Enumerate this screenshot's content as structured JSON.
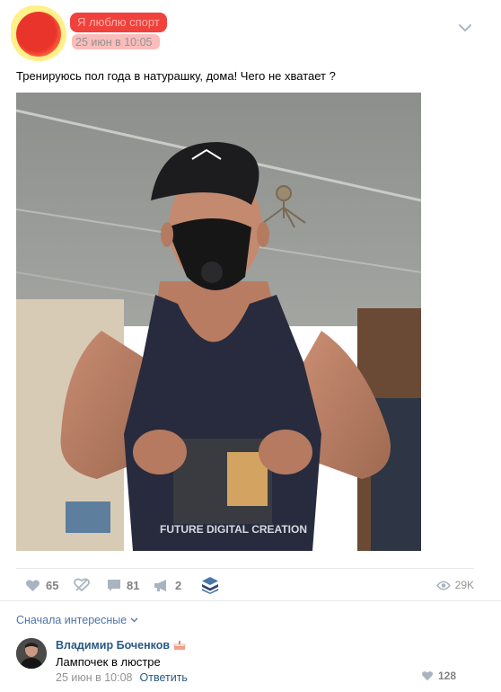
{
  "post": {
    "group_name": "Я люблю спорт",
    "date": "25 июн в 10:05",
    "text": "Тренируюсь пол года в натурашку, дома! Чего не хватает ?",
    "shirt_print": "FUTURE DIGITAL CREATION"
  },
  "actions": {
    "likes": "65",
    "comments": "81",
    "reposts": "2",
    "views": "29K"
  },
  "comments_sort": {
    "label": "Сначала интересные"
  },
  "comment": {
    "author": "Владимир Боченков",
    "text": "Лампочек в люстре",
    "date": "25 июн в 10:08",
    "reply_label": "Ответить",
    "likes": "128"
  },
  "colors": {
    "link": "#2a5885",
    "accent": "#4a76a8",
    "muted": "#939393"
  }
}
